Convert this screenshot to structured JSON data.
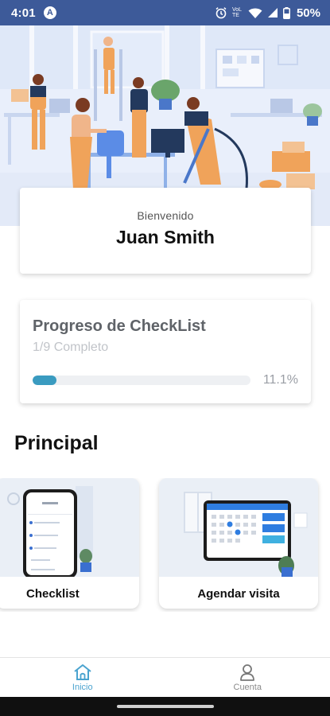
{
  "status_bar": {
    "time": "4:01",
    "app_badge": "A",
    "network_label": "VoLTE",
    "battery": "50%"
  },
  "welcome": {
    "greeting": "Bienvenido",
    "user_name": "Juan Smith"
  },
  "progress": {
    "title": "Progreso de CheckList",
    "subtitle": "1/9 Completo",
    "percent_label": "11.1%",
    "fraction": 0.111
  },
  "section": {
    "title": "Principal"
  },
  "cards": [
    {
      "label": "Checklist"
    },
    {
      "label": "Agendar visita"
    }
  ],
  "bottom_nav": {
    "items": [
      {
        "label": "Inicio",
        "icon": "home-icon",
        "active": true
      },
      {
        "label": "Cuenta",
        "icon": "user-icon",
        "active": false
      }
    ]
  },
  "colors": {
    "status_bar": "#3d5a99",
    "progress_fill": "#3a9bc0",
    "accent": "#4aa3cf"
  }
}
